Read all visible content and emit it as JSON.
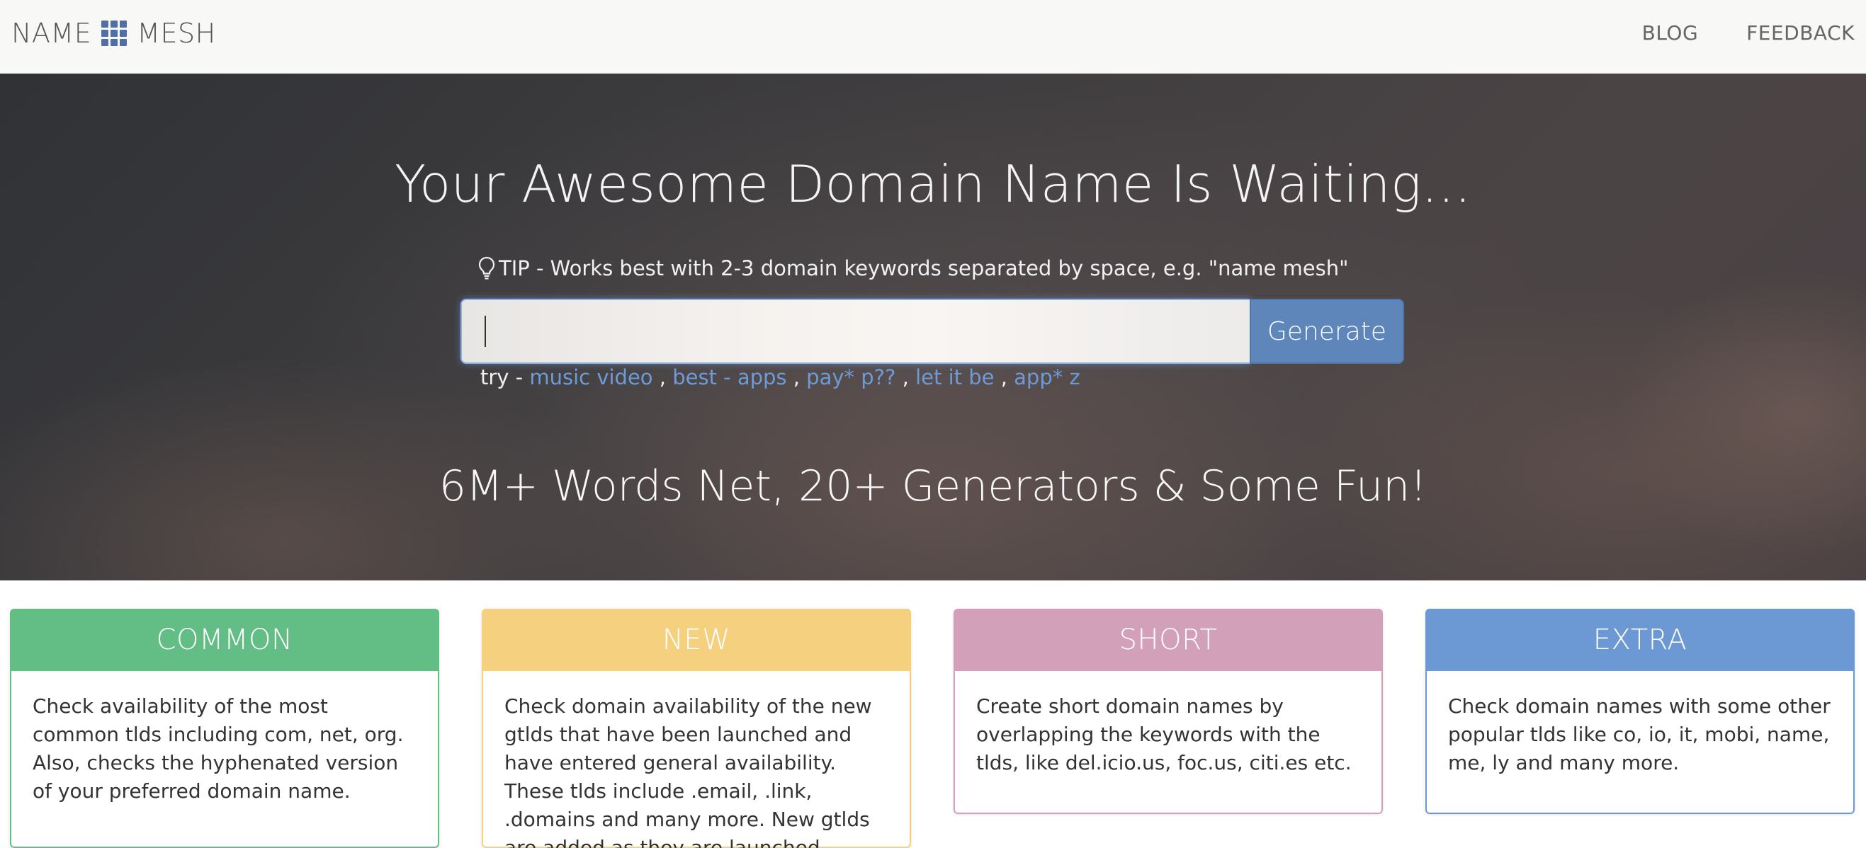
{
  "navbar": {
    "brand_left": "NAME",
    "brand_right": "MESH",
    "links": [
      "BLOG",
      "FEEDBACK"
    ]
  },
  "hero": {
    "title": "Your Awesome Domain Name Is Waiting...",
    "tip": "TIP - Works best with 2-3 domain keywords separated by space, e.g. \"name mesh\"",
    "search": {
      "value": "",
      "placeholder": "",
      "button_label": "Generate"
    },
    "try_label": "try -",
    "try_examples": [
      "music video",
      "best - apps",
      "pay* p??",
      "let it be",
      "app* z"
    ],
    "subtitle": "6M+ Words Net, 20+ Generators & Some Fun!"
  },
  "cards": [
    {
      "title": "COMMON",
      "color": "#63be86",
      "text": "Check availability of the most common tlds including com, net, org. Also, checks the hyphenated version of your preferred domain name."
    },
    {
      "title": "NEW",
      "color": "#f5d07f",
      "text": "Check domain availability of the new gtlds that have been launched and have entered general availability. These tlds include .email, .link, .domains and many more. New gtlds are added as they are launched."
    },
    {
      "title": "SHORT",
      "color": "#d2a1b9",
      "text": "Create short domain names by overlapping the keywords with the tlds, like del.icio.us, foc.us, citi.es etc."
    },
    {
      "title": "EXTRA",
      "color": "#6c98d3",
      "text": "Check domain names with some other popular tlds like co, io, it, mobi, name, me, ly and many more."
    }
  ],
  "icons": {
    "brand": "grid-icon",
    "tip": "lightbulb-icon"
  }
}
